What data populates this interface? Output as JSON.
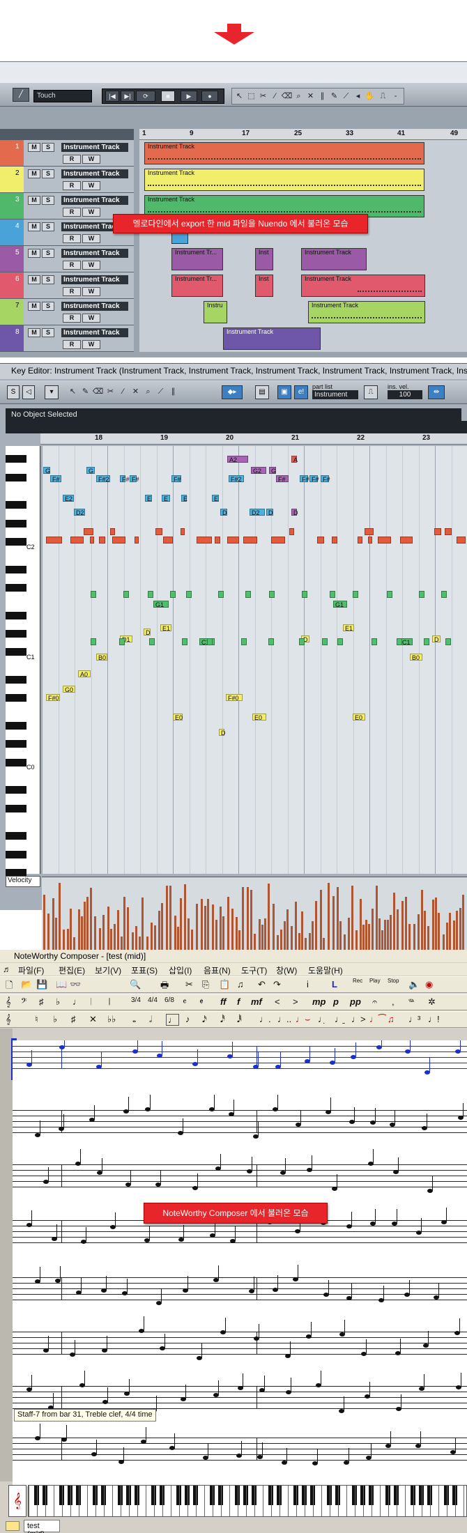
{
  "nuendo": {
    "automation_mode": "Touch",
    "ruler_marks": [
      "1",
      "9",
      "17",
      "25",
      "33",
      "41",
      "49"
    ],
    "mute_label": "M",
    "solo_label": "S",
    "read_label": "R",
    "write_label": "W",
    "tracks": [
      {
        "num": "1",
        "name": "Instrument Track",
        "color": "#e36a4c"
      },
      {
        "num": "2",
        "name": "Instrument Track",
        "color": "#f0ee6a"
      },
      {
        "num": "3",
        "name": "Instrument Track",
        "color": "#4fb86b"
      },
      {
        "num": "4",
        "name": "Instrument Track",
        "color": "#4aa3d8"
      },
      {
        "num": "5",
        "name": "Instrument Track",
        "color": "#9a5aa6"
      },
      {
        "num": "6",
        "name": "Instrument Track",
        "color": "#e0596c"
      },
      {
        "num": "7",
        "name": "Instrument Track",
        "color": "#a6d564"
      },
      {
        "num": "8",
        "name": "Instrument Track",
        "color": "#6e57a8"
      }
    ],
    "part_label": "Instrument Track",
    "part_label_short": "Instrument Tr...",
    "part_label_tiny": "Inst",
    "part_label_mini": "Instru",
    "callout": "멜로다인에서 export 한 mid 파일을 Nuendo 에서 불러온 모습"
  },
  "key_editor": {
    "title": "Key Editor: Instrument Track (Instrument Track, Instrument Track, Instrument Track, Instrument Track, Instrument Track, Instrument",
    "status": "No Object Selected",
    "part_list_label": "part list",
    "part_list_value": "Instrument",
    "ins_vel_label": "ins. vel.",
    "ins_vel_value": "100",
    "ruler_marks": [
      "18",
      "19",
      "20",
      "21",
      "22",
      "23"
    ],
    "octave_labels": [
      "C2",
      "C1",
      "C0"
    ],
    "velocity_label": "Velocity",
    "note_labels": [
      "A2",
      "A",
      "G",
      "G",
      "G2",
      "G",
      "F#",
      "F#2",
      "F#",
      "F#",
      "F#",
      "F#2",
      "F#",
      "F#",
      "F#",
      "F#",
      "E2",
      "E",
      "E",
      "E",
      "E",
      "D2",
      "D",
      "D2",
      "D",
      "D",
      "C1",
      "C1",
      "B0",
      "A0",
      "G0",
      "F#0",
      "F#0",
      "E0",
      "E0",
      "E0",
      "D",
      "G1",
      "G1",
      "E1",
      "E1",
      "D1",
      "D",
      "D",
      "D",
      "B0"
    ]
  },
  "noteworthy": {
    "title": "NoteWorthy Composer - [test (mid)]",
    "menu": [
      "파일(F)",
      "편집(E)",
      "보기(V)",
      "포표(S)",
      "삽입(I)",
      "음표(N)",
      "도구(T)",
      "창(W)",
      "도움말(H)"
    ],
    "record_labels": [
      "Rec",
      "Play",
      "Stop"
    ],
    "dynamics": [
      "ff",
      "f",
      "mf",
      "mp",
      "p",
      "pp"
    ],
    "callout": "NoteWorthy Composer 에서 불러온 모습",
    "status_tooltip": "Staff-7 from bar 31, Treble clef, 4/4 time",
    "tab_label": "test (mid)"
  }
}
